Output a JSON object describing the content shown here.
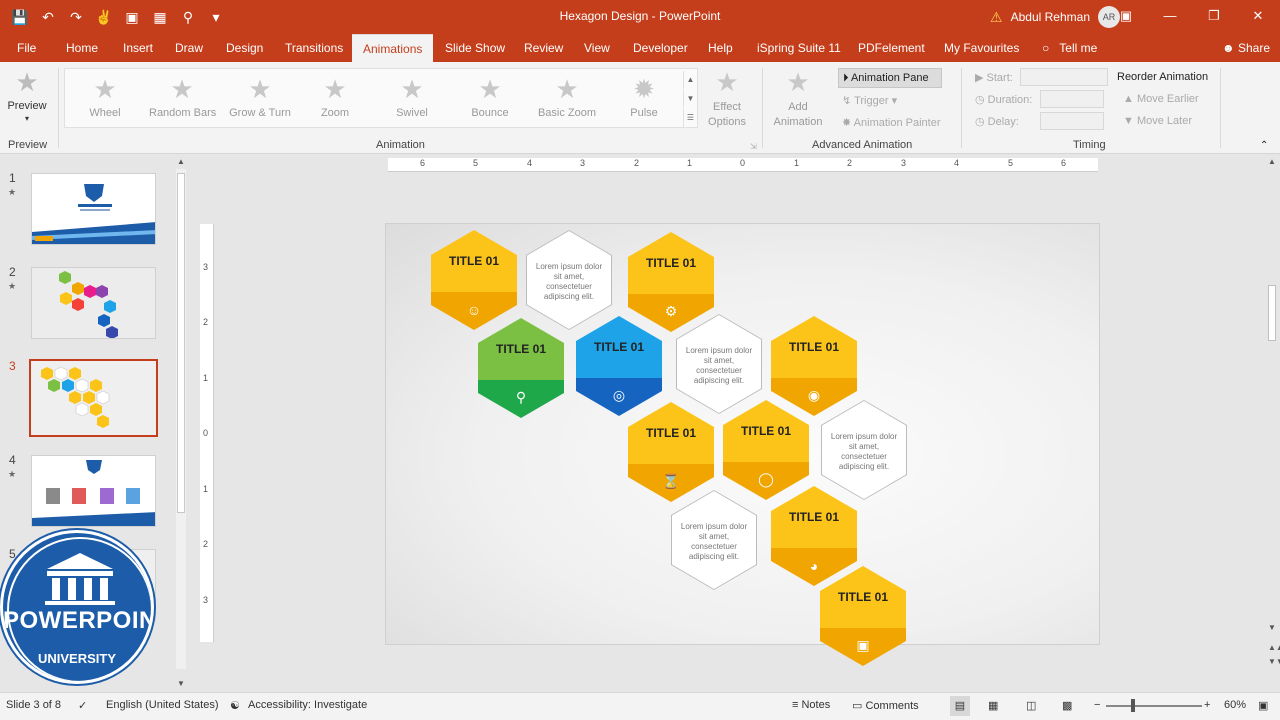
{
  "window": {
    "title": "Hexagon Design  -  PowerPoint",
    "user_name": "Abdul Rehman",
    "user_initials": "AR"
  },
  "tabs": [
    "File",
    "Home",
    "Insert",
    "Draw",
    "Design",
    "Transitions",
    "Animations",
    "Slide Show",
    "Review",
    "View",
    "Developer",
    "Help",
    "iSpring Suite 11",
    "PDFelement",
    "My Favourites"
  ],
  "active_tab": "Animations",
  "tell_me": "Tell me",
  "share": "Share",
  "ribbon": {
    "preview": {
      "label": "Preview",
      "group": "Preview"
    },
    "animation_gallery": [
      "Wheel",
      "Random Bars",
      "Grow & Turn",
      "Zoom",
      "Swivel",
      "Bounce",
      "Basic Zoom",
      "Pulse"
    ],
    "effect_options": "Effect Options",
    "animation_group": "Animation",
    "add_animation": "Add Animation",
    "animation_pane": "Animation Pane",
    "trigger": "Trigger",
    "animation_painter": "Animation Painter",
    "advanced_group": "Advanced Animation",
    "start": "Start:",
    "duration": "Duration:",
    "delay": "Delay:",
    "reorder": "Reorder Animation",
    "move_earlier": "Move Earlier",
    "move_later": "Move Later",
    "timing_group": "Timing"
  },
  "thumbnails": {
    "numbers": [
      "1",
      "2",
      "3",
      "4",
      "5"
    ],
    "selected": "3"
  },
  "ruler": {
    "h": [
      "6",
      "5",
      "4",
      "3",
      "2",
      "1",
      "0",
      "1",
      "2",
      "3",
      "4",
      "5",
      "6"
    ],
    "v": [
      "3",
      "2",
      "1",
      "0",
      "1",
      "2",
      "3"
    ]
  },
  "slide": {
    "hex_title": "TITLE 01",
    "lorem": "Lorem ipsum dolor sit amet, consectetuer adipiscing elit."
  },
  "statusbar": {
    "slide_info": "Slide 3 of 8",
    "language": "English (United States)",
    "accessibility": "Accessibility: Investigate",
    "notes": "Notes",
    "comments": "Comments",
    "zoom": "60%"
  },
  "logo": {
    "word": "POWERPOINT",
    "sub": "UNIVERSITY"
  },
  "colors": {
    "accent": "#c43e1c",
    "hex_yellow": "#fcc419",
    "hex_yellow_dark": "#f0a500",
    "hex_green": "#7bc043",
    "hex_green_dark": "#1fa84a",
    "hex_blue": "#1fa3e8",
    "hex_blue_dark": "#1565c0"
  }
}
